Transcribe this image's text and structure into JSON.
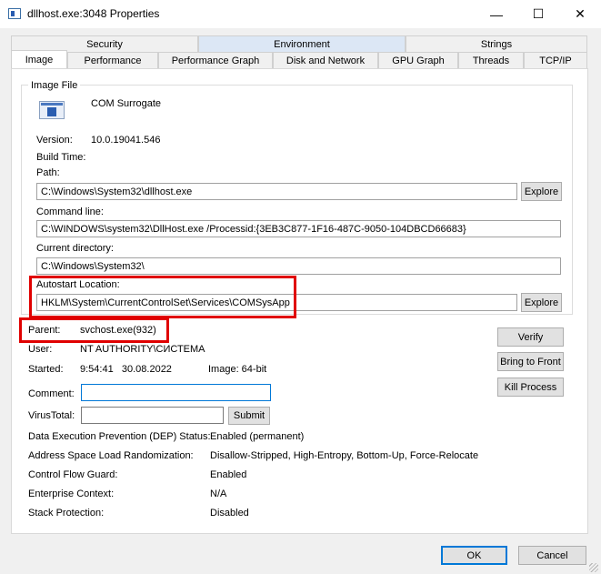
{
  "window": {
    "title": "dllhost.exe:3048 Properties"
  },
  "controls": {
    "minimize": "—",
    "maximize": "☐",
    "close": "✕"
  },
  "tabs_back": [
    "Security",
    "Environment",
    "Strings"
  ],
  "tabs_front": [
    "Image",
    "Performance",
    "Performance Graph",
    "Disk and Network",
    "GPU Graph",
    "Threads",
    "TCP/IP"
  ],
  "image_file": {
    "group_label": "Image File",
    "description": "COM Surrogate",
    "version_label": "Version:",
    "version": "10.0.19041.546",
    "build_time_label": "Build Time:",
    "path_label": "Path:",
    "path": "C:\\Windows\\System32\\dllhost.exe",
    "cmdline_label": "Command line:",
    "cmdline": "C:\\WINDOWS\\system32\\DllHost.exe /Processid:{3EB3C877-1F16-487C-9050-104DBCD66683}",
    "curdir_label": "Current directory:",
    "curdir": "C:\\Windows\\System32\\",
    "autostart_label": "Autostart Location:",
    "autostart": "HKLM\\System\\CurrentControlSet\\Services\\COMSysApp",
    "explore_label": "Explore"
  },
  "process": {
    "parent_label": "Parent:",
    "parent": "svchost.exe(932)",
    "user_label": "User:",
    "user": "NT AUTHORITY\\СИСТЕМА",
    "started_label": "Started:",
    "started": "9:54:41   30.08.2022",
    "image_type": "Image: 64-bit",
    "comment_label": "Comment:",
    "comment_value": "",
    "virustotal_label": "VirusTotal:",
    "virustotal_value": "",
    "submit_label": "Submit"
  },
  "side_buttons": {
    "verify": "Verify",
    "bring_to_front": "Bring to Front",
    "kill_process": "Kill Process"
  },
  "security_props": [
    {
      "label": "Data Execution Prevention (DEP) Status:",
      "value": "Enabled (permanent)"
    },
    {
      "label": "Address Space Load Randomization:",
      "value": "Disallow-Stripped, High-Entropy, Bottom-Up, Force-Relocate"
    },
    {
      "label": "Control Flow Guard:",
      "value": "Enabled"
    },
    {
      "label": "Enterprise Context:",
      "value": "N/A"
    },
    {
      "label": "Stack Protection:",
      "value": "Disabled"
    }
  ],
  "footer": {
    "ok": "OK",
    "cancel": "Cancel"
  }
}
